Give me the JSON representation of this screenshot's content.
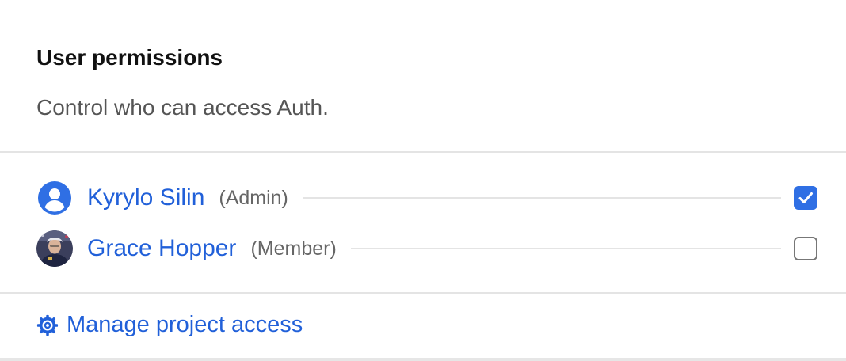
{
  "section": {
    "title": "User permissions",
    "subtitle": "Control who can access Auth."
  },
  "users": [
    {
      "name": "Kyrylo Silin",
      "role": "(Admin)",
      "avatar_icon": "user-circle-icon",
      "checked": true
    },
    {
      "name": "Grace Hopper",
      "role": "(Member)",
      "avatar_icon": "photo-avatar",
      "checked": false
    }
  ],
  "footer": {
    "manage_label": "Manage project access",
    "icon": "gear-icon"
  },
  "colors": {
    "link": "#2160d9",
    "checkbox_checked": "#2f6fe4",
    "muted_text": "#555555",
    "divider": "#e4e4e4"
  }
}
